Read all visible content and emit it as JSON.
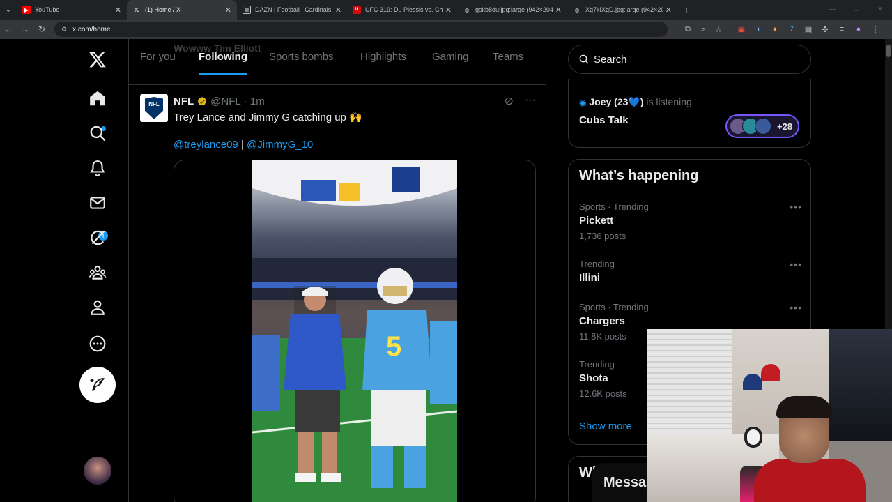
{
  "browser": {
    "tabs": [
      {
        "title": "YouTube",
        "favicon": "youtube-icon",
        "color": "#ff0000",
        "active": false
      },
      {
        "title": "(1) Home / X",
        "favicon": "x-logo-icon",
        "color": "#ffffff",
        "active": true
      },
      {
        "title": "DAZN | Football | Cardinals @",
        "favicon": "dazn-icon",
        "color": "#e8eaed",
        "active": false
      },
      {
        "title": "UFC 319: Du Plessis vs. Chimae",
        "favicon": "ufc-icon",
        "color": "#d20a0a",
        "active": false
      },
      {
        "title": "gskb8duIjpg:large (942×2048)",
        "favicon": "globe-icon",
        "color": "#bdc1c6",
        "active": false
      },
      {
        "title": "Xg7kIXgD.jpg:large (942×2048)",
        "favicon": "globe-icon",
        "color": "#bdc1c6",
        "active": false
      }
    ],
    "url": "x.com/home"
  },
  "nav": {
    "logo": "x-logo-icon",
    "items": [
      "home",
      "explore",
      "notifications",
      "messages",
      "grok",
      "communities",
      "profile",
      "more"
    ],
    "messages_badge": "1",
    "accent": "#1d9bf0"
  },
  "feed": {
    "ghost_text": "Wowww Tim Elliott",
    "tabs": [
      "For you",
      "Following",
      "Sports bombs",
      "Highlights",
      "Gaming",
      "Teams"
    ],
    "active_tab": "Following"
  },
  "post": {
    "author": "NFL",
    "handle": "@NFL",
    "time": "· 1m",
    "text": "Trey Lance and Jimmy G catching up 🙌",
    "mention1": "@treylance09",
    "separator": "|",
    "mention2": "@JimmyG_10"
  },
  "sidebar": {
    "search_placeholder": "Search",
    "space": {
      "listener_name": "Joey (23💙)",
      "listener_status": "is listening",
      "title": "Cubs Talk",
      "listener_count": "+28"
    },
    "happening_title": "What’s happening",
    "trends": [
      {
        "context": "Sports · Trending",
        "name": "Pickett",
        "posts": "1,736 posts"
      },
      {
        "context": "Trending",
        "name": "Illini",
        "posts": ""
      },
      {
        "context": "Sports · Trending",
        "name": "Chargers",
        "posts": "11.8K posts"
      },
      {
        "context": "Trending",
        "name": "Shota",
        "posts": "12.6K posts"
      }
    ],
    "show_more": "Show more",
    "who_partial": "Wh"
  },
  "messages_drawer": "Messa"
}
